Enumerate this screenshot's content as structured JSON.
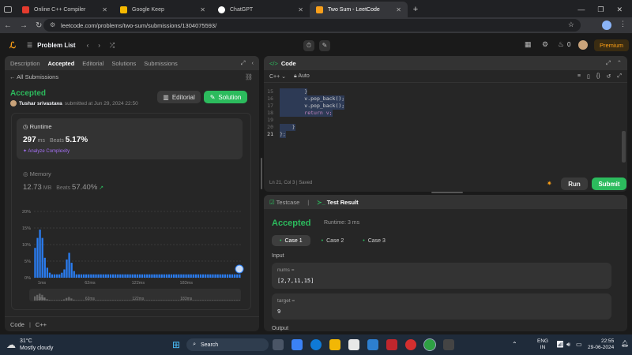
{
  "browser": {
    "tabs": [
      {
        "title": "Online C++ Compiler",
        "color": "#e33b2e"
      },
      {
        "title": "Google Keep",
        "color": "#f6b900"
      },
      {
        "title": "ChatGPT",
        "color": "#ffffff"
      },
      {
        "title": "Two Sum - LeetCode",
        "color": "#f89f1b"
      }
    ],
    "url": "leetcode.com/problems/two-sum/submissions/1304075593/"
  },
  "lc_header": {
    "problem_list": "Problem List",
    "streak": "0",
    "premium": "Premium"
  },
  "left": {
    "tabs": [
      "Description",
      "Accepted",
      "Editorial",
      "Solutions",
      "Submissions"
    ],
    "back": "All Submissions",
    "status": "Accepted",
    "submitter": "Tushar srivastava",
    "submitted_at": "submitted at Jun 29, 2024 22:50",
    "editorial_btn": "Editorial",
    "solution_btn": "Solution",
    "runtime_title": "Runtime",
    "runtime_value": "297",
    "runtime_unit": "ms",
    "beats_label": "Beats",
    "runtime_beats": "5.17%",
    "analyze": "Analyze Complexity",
    "memory_title": "Memory",
    "memory_value": "12.73",
    "memory_unit": "MB",
    "memory_beats": "57.40%",
    "footer": [
      "Code",
      "C++"
    ]
  },
  "chart_data": {
    "type": "bar",
    "y_ticks": [
      "20%",
      "15%",
      "10%",
      "5%",
      "0%"
    ],
    "x_ticks": [
      "1ms",
      "62ms",
      "122ms",
      "183ms"
    ],
    "ylim": [
      0,
      20
    ],
    "values": [
      9,
      12,
      14.5,
      12,
      6,
      3,
      1.5,
      1,
      1,
      1,
      1,
      1.5,
      2.5,
      5.5,
      7.5,
      4.5,
      2,
      1,
      1,
      1,
      1,
      1,
      1,
      1,
      1,
      1,
      1,
      1,
      1,
      1,
      1,
      1,
      1,
      1,
      1,
      1,
      1,
      1,
      1,
      1,
      1,
      1,
      1,
      1,
      1,
      1,
      1,
      1,
      1,
      1,
      1,
      1,
      1,
      1,
      1,
      1,
      1,
      1,
      1,
      1,
      1,
      1,
      1,
      1,
      1,
      1,
      1,
      1,
      1,
      1,
      1,
      1,
      1,
      1,
      1,
      1,
      1,
      1,
      1,
      1,
      1,
      1,
      1,
      1,
      1
    ],
    "bar_color": "#2a7df2",
    "highlight_color": "#3b8ff5"
  },
  "code": {
    "title": "Code",
    "language": "C++",
    "mode": "Auto",
    "lines": [
      {
        "n": "15",
        "t": "        }"
      },
      {
        "n": "16",
        "t": "        v.pop_back();"
      },
      {
        "n": "17",
        "t": "        v.pop_back();"
      },
      {
        "n": "18",
        "t": "        return v;"
      },
      {
        "n": "19",
        "t": ""
      },
      {
        "n": "20",
        "t": "    }"
      },
      {
        "n": "21",
        "t": "};"
      }
    ],
    "status": "Ln 21, Col 3",
    "saved": "Saved",
    "run": "Run",
    "submit": "Submit"
  },
  "result": {
    "tab_testcase": "Testcase",
    "tab_result": "Test Result",
    "status": "Accepted",
    "runtime": "Runtime: 3 ms",
    "cases": [
      "Case 1",
      "Case 2",
      "Case 3"
    ],
    "input_label": "Input",
    "nums_label": "nums =",
    "nums_value": "[2,7,11,15]",
    "target_label": "target =",
    "target_value": "9",
    "output_label": "Output"
  },
  "taskbar": {
    "temp": "31°C",
    "weather": "Mostly cloudy",
    "search": "Search",
    "lang1": "ENG",
    "lang2": "IN",
    "time": "22:55",
    "date": "29-06-2024"
  }
}
